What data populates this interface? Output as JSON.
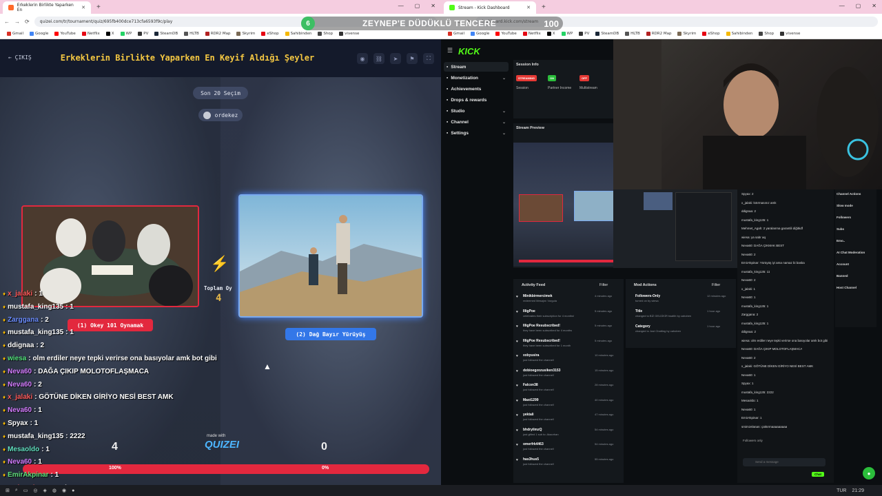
{
  "left_browser": {
    "tab_title": "Erkeklerin Birlikte Yaparken En",
    "url": "quizei.com/tr/tournament/quiz/695fb400dce713cfa6593f9c/play",
    "bookmarks": [
      "Gmail",
      "Google",
      "YouTube",
      "Netflix",
      "X",
      "WP",
      "PV",
      "SteamDB",
      "HLTB",
      "RDR2 Map",
      "Skyrim",
      "eShop",
      "Sahibinden",
      "Shop",
      "vivense"
    ]
  },
  "right_browser": {
    "tab_title": "Stream - Kick Dashboard",
    "url": "dashboard.kick.com/stream",
    "bookmarks": [
      "Gmail",
      "Google",
      "YouTube",
      "Netflix",
      "X",
      "WP",
      "PV",
      "SteamDB",
      "HLTB",
      "RDR2 Map",
      "Skyrim",
      "eShop",
      "Sahibinden",
      "Shop",
      "vivense"
    ]
  },
  "overlay": {
    "left_num": "6",
    "text": "ZEYNEP'E DÜDÜKLÜ TENCERE",
    "right_num": "100"
  },
  "quiz": {
    "exit_label": "← ÇIKIŞ",
    "title": "Erkeklerin Birlikte Yaparken En Keyif Aldığı Şeyler",
    "last_label": "Son 20 Seçim",
    "user": "ordekez",
    "total_label": "Toplam Oy",
    "total_value": "4",
    "option1": "(1) Okey 101 Oynamak",
    "option2": "(2) Dağ Bayır Yürüyüş",
    "score1": "4",
    "score2": "0",
    "made_with": "made with",
    "logo": "QUIZEI",
    "percent1": "100%",
    "percent2": "0%",
    "progress_fraction": 1.0
  },
  "stream_chat": [
    {
      "user": "x_jalaki",
      "msg": ": 1",
      "color": "#ff5b5b"
    },
    {
      "user": "mustafa_king135",
      "msg": ": 1",
      "color": "#ffffff"
    },
    {
      "user": "Zarggana",
      "msg": ": 2",
      "color": "#6a8cff"
    },
    {
      "user": "mustafa_king135",
      "msg": ": 1",
      "color": "#ffffff"
    },
    {
      "user": "ddignaa",
      "msg": ": 2",
      "color": "#ffffff"
    },
    {
      "user": "wiesa",
      "msg": ": olm erdiler neye tepki verirse ona basıyolar amk bot gibi",
      "color": "#52e07a"
    },
    {
      "user": "Neva60",
      "msg": ": DAĞA ÇIKIP MOLOTOFLAŞMACA",
      "color": "#d47bff"
    },
    {
      "user": "Neva60",
      "msg": ": 2",
      "color": "#d47bff"
    },
    {
      "user": "x_jalaki",
      "msg": ": GÖTÜNE DİKEN GİRİYO NESİ BEST AMK",
      "color": "#ff5b5b"
    },
    {
      "user": "Neva60",
      "msg": ": 1",
      "color": "#d47bff"
    },
    {
      "user": "Spyax",
      "msg": ": 1",
      "color": "#ffffff"
    },
    {
      "user": "mustafa_king135",
      "msg": ": 2222",
      "color": "#ffffff"
    },
    {
      "user": "Mesaoldo",
      "msg": ": 1",
      "color": "#61e0c0"
    },
    {
      "user": "Neva60",
      "msg": ": 1",
      "color": "#d47bff"
    },
    {
      "user": "EmirAkpinar",
      "msg": ": 1",
      "color": "#5fe07a"
    },
    {
      "user": "smimzelanan",
      "msg": ": çaktırmaaaaaaaaa",
      "color": "#ff5b5b"
    }
  ],
  "kick": {
    "logo": "KICK",
    "nav": [
      {
        "label": "Stream",
        "chev": ""
      },
      {
        "label": "Monetization",
        "chev": "⌄"
      },
      {
        "label": "Achievements",
        "chev": ""
      },
      {
        "label": "Drops & rewards",
        "chev": ""
      },
      {
        "label": "Studio",
        "chev": "⌄"
      },
      {
        "label": "Channel",
        "chev": "⌄"
      },
      {
        "label": "Settings",
        "chev": "⌄"
      }
    ],
    "session_info": "Session Info",
    "badges": [
      {
        "text": "STREAMING",
        "label": "Session",
        "color": "#e53935"
      },
      {
        "text": "ON",
        "label": "Partner Income",
        "color": "#2bbd3b"
      },
      {
        "text": "OFF",
        "label": "Multistream",
        "color": "#e53935"
      }
    ],
    "stream_preview": "Stream Preview",
    "activity_feed": "Activity Feed",
    "mod_actions": "Mod Actions",
    "filter": "Filter",
    "feed": [
      {
        "name": "Minikbirmercimek",
        "sub": "redeemed Mesajını Vurgula",
        "time": "4 minutes ago"
      },
      {
        "name": "IlligPoe",
        "sub": "celebrates their subscription for 4 months!",
        "time": "5 minutes ago"
      },
      {
        "name": "IlligPoe Resubscribed!",
        "sub": "they have been subscribed for 4 months",
        "time": "5 minutes ago"
      },
      {
        "name": "IlligPoe Resubscribed!",
        "sub": "they have been subscribed for 1 month",
        "time": "5 minutes ago"
      },
      {
        "name": "xxbyusira",
        "sub": "just followed the channel!",
        "time": "10 minutes ago"
      },
      {
        "name": "dobioegzozusiken3153",
        "sub": "just followed the channel!",
        "time": "15 minutes ago"
      },
      {
        "name": "Falcon38",
        "sub": "just followed the channel!",
        "time": "28 minutes ago"
      },
      {
        "name": "Mast1299",
        "sub": "just followed the channel!",
        "time": "40 minutes ago"
      },
      {
        "name": "yektali",
        "sub": "just followed the channel!",
        "time": "47 minutes ago"
      },
      {
        "name": "bhdryilmzQ",
        "sub": "just gifted 1 sub to: Akaorhan",
        "time": "54 minutes ago"
      },
      {
        "name": "omerfrk4463",
        "sub": "just followed the channel!",
        "time": "54 minutes ago"
      },
      {
        "name": "has3hus5",
        "sub": "just followed the channel!",
        "time": "55 minutes ago"
      }
    ],
    "mod": [
      {
        "name": "Followers-Only",
        "sub": "turned on by wiesa",
        "time": "12 minutes ago"
      },
      {
        "name": "Title",
        "sub": "changed to BİZ GELDİKİR twaltih by cahoben",
        "time": "1 hour ago"
      },
      {
        "name": "Category",
        "sub": "changed to Just Chatting by cahoben",
        "time": "1 hour ago"
      }
    ],
    "chat_lines": [
      "Spyax: 2",
      "x_jalaki: kıtırmasınız amk",
      "ddignaa: 2",
      "mustafa_king135: 1",
      "Mehmet_Agah: 2 yaralanma garantili diğitkdf",
      "wiesa: ya sabr aq",
      "Neva60: DAĞA ÇIKMAK BEST",
      "Neva60: 2",
      "EmirAkpinar: Yürüyüş iyi ama namaz bi baska",
      "mustafa_king135: 11",
      "Neva60: 2",
      "x_jalaki: 1",
      "Neva60: 1",
      "mustafa_king135: 1",
      "Zarggana: 2",
      "mustafa_king135: 1",
      "ddignaa: 2",
      "wiesa: olm erdiler neye tepki verirse ona basıyolar amk bot gibi",
      "Neva60: DAĞA ÇIKIP MOLOTOFLAŞMACA",
      "Neva60: 2",
      "x_jalaki: GÖTÜNE DİKEN GİRİYO NESİ BEST AMK",
      "Neva60: 1",
      "Spyax: 1",
      "mustafa_king135: 2222",
      "Mesaoldo: 1",
      "Neva60: 1",
      "EmirAkpinar: 1",
      "smimzelanan: çaktırmaaaaaaaaa"
    ],
    "send_placeholder": "Send a message",
    "chat_button": "Chat",
    "followers_only": "Followers only",
    "right_panel": [
      "Channel Actions",
      "Slow mode",
      "Followers",
      "Subs",
      "Emo..",
      "AI Chat Moderation",
      "Account",
      "Banned",
      "Host Channel"
    ]
  },
  "taskbar": {
    "lang": "TUR",
    "time": "21:29"
  }
}
